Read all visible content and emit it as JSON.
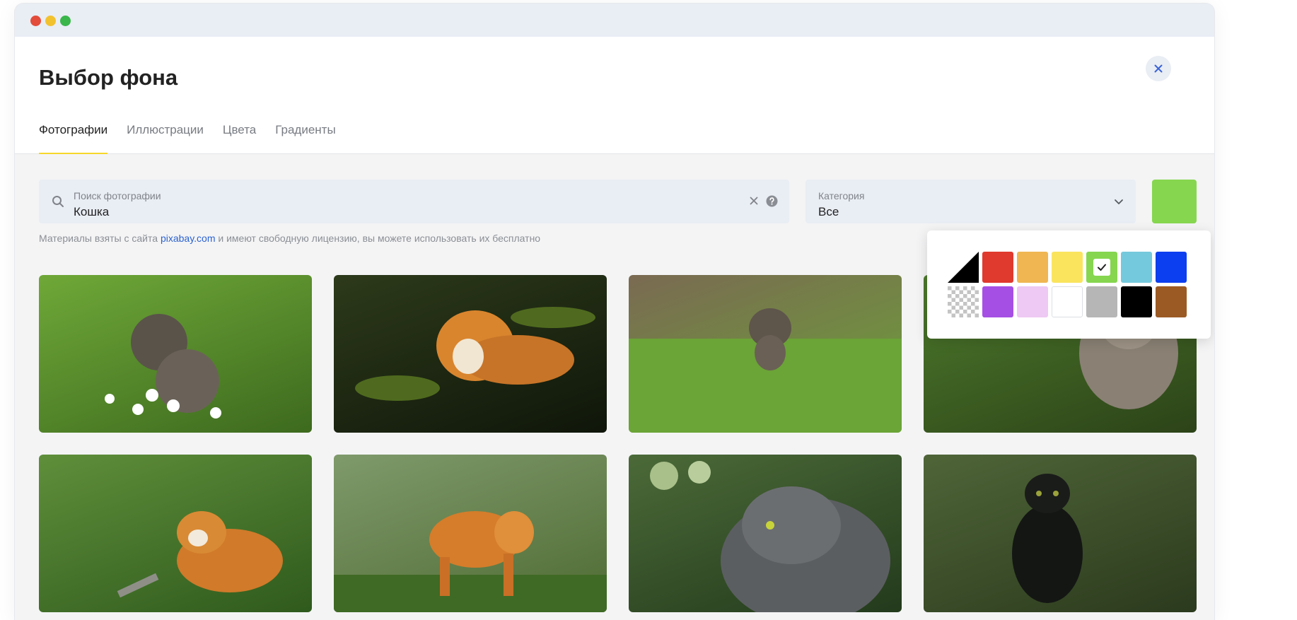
{
  "window": {
    "controls": [
      "close",
      "minimize",
      "zoom"
    ],
    "control_colors": [
      "#e34b3a",
      "#f2c22e",
      "#3ab64a"
    ]
  },
  "header": {
    "title": "Выбор фона",
    "tabs": [
      {
        "label": "Фотографии",
        "active": true
      },
      {
        "label": "Иллюстрации",
        "active": false
      },
      {
        "label": "Цвета",
        "active": false
      },
      {
        "label": "Градиенты",
        "active": false
      }
    ],
    "close_icon": "close-icon"
  },
  "search": {
    "label": "Поиск фотографии",
    "value": "Кошка",
    "icons": [
      "search-icon",
      "clear-icon",
      "help-icon"
    ]
  },
  "category": {
    "label": "Категория",
    "value": "Все",
    "icon": "chevron-down-icon"
  },
  "selected_color": "#86d64f",
  "note": {
    "before": "Материалы взяты с сайта ",
    "link": "pixabay.com",
    "after": " и имеют свободную лицензию, вы можете использовать их бесплатно"
  },
  "palette": {
    "selected_index": 4,
    "swatches": [
      {
        "name": "black-white-diagonal",
        "color": "#000000"
      },
      {
        "name": "red",
        "color": "#e0392e"
      },
      {
        "name": "orange",
        "color": "#efb652"
      },
      {
        "name": "yellow",
        "color": "#fae45e"
      },
      {
        "name": "green",
        "color": "#86d64f"
      },
      {
        "name": "light-blue",
        "color": "#75c9dd"
      },
      {
        "name": "blue",
        "color": "#0c3fef"
      },
      {
        "name": "transparent",
        "color": "transparent"
      },
      {
        "name": "purple",
        "color": "#a64fe4"
      },
      {
        "name": "light-pink",
        "color": "#eec9f3"
      },
      {
        "name": "white",
        "color": "#ffffff"
      },
      {
        "name": "gray",
        "color": "#b6b6b6"
      },
      {
        "name": "black",
        "color": "#000000"
      },
      {
        "name": "brown",
        "color": "#9b5a24"
      }
    ]
  },
  "photos": [
    {
      "subject": "kitten-in-daisies",
      "colors": [
        "#6fa838",
        "#3d6a1e"
      ]
    },
    {
      "subject": "tiger-in-water",
      "colors": [
        "#2d3a1a",
        "#0f160a"
      ]
    },
    {
      "subject": "kitten-walking-grass",
      "colors": [
        "#7a6a52",
        "#6ba437"
      ]
    },
    {
      "subject": "cat-in-grass",
      "colors": [
        "#4d7a2c",
        "#2c4318"
      ]
    },
    {
      "subject": "tiger-lying-grass",
      "colors": [
        "#5f8f3a",
        "#2f5a1d"
      ]
    },
    {
      "subject": "tiger-standing",
      "colors": [
        "#7f9a6b",
        "#4f6b33"
      ]
    },
    {
      "subject": "gray-cat-profile",
      "colors": [
        "#4b6a38",
        "#233a1c"
      ]
    },
    {
      "subject": "black-cat-grass",
      "colors": [
        "#4f6538",
        "#2b3a1d"
      ]
    }
  ]
}
